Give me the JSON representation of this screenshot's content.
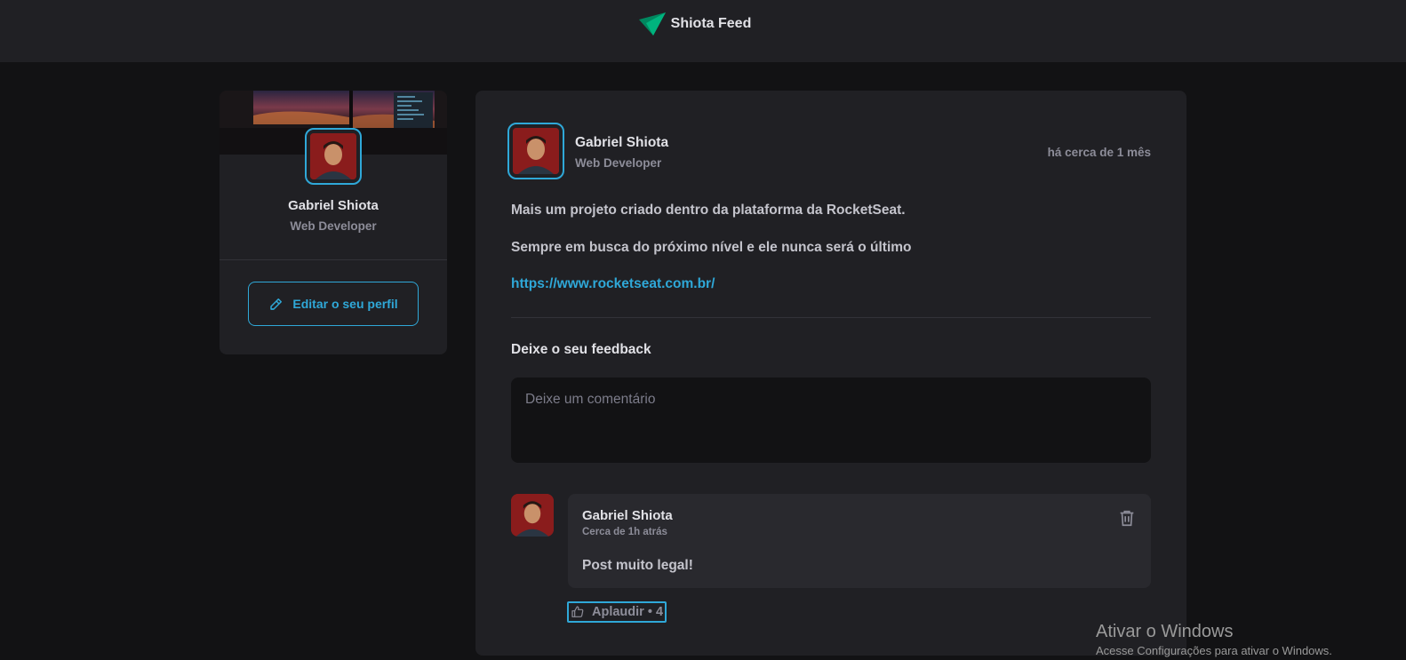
{
  "header": {
    "title": "Shiota Feed",
    "logo_icon": "paper-plane-icon",
    "accent": "#00b37e"
  },
  "sidebar": {
    "name": "Gabriel Shiota",
    "role": "Web Developer",
    "edit_label": "Editar o seu perfil",
    "edit_icon": "pencil-icon"
  },
  "post": {
    "author_name": "Gabriel Shiota",
    "author_role": "Web Developer",
    "time": "há cerca de 1 mês",
    "paragraphs": [
      "Mais um projeto criado dentro da plataforma da RocketSeat.",
      "Sempre em busca do próximo nível e ele nunca será o último"
    ],
    "link": "https://www.rocketseat.com.br/"
  },
  "feedback": {
    "title": "Deixe o seu feedback",
    "placeholder": "Deixe um comentário"
  },
  "comment": {
    "author": "Gabriel Shiota",
    "time": "Cerca de 1h atrás",
    "text": "Post muito legal!",
    "applaud_label": "Aplaudir • 4",
    "trash_icon": "trash-icon",
    "applaud_icon": "thumbs-up-icon"
  },
  "watermark": {
    "title": "Ativar o Windows",
    "subtitle": "Acesse Configurações para ativar o Windows."
  },
  "colors": {
    "accent": "#2fa8d8",
    "background": "#121214",
    "card": "#202024"
  }
}
